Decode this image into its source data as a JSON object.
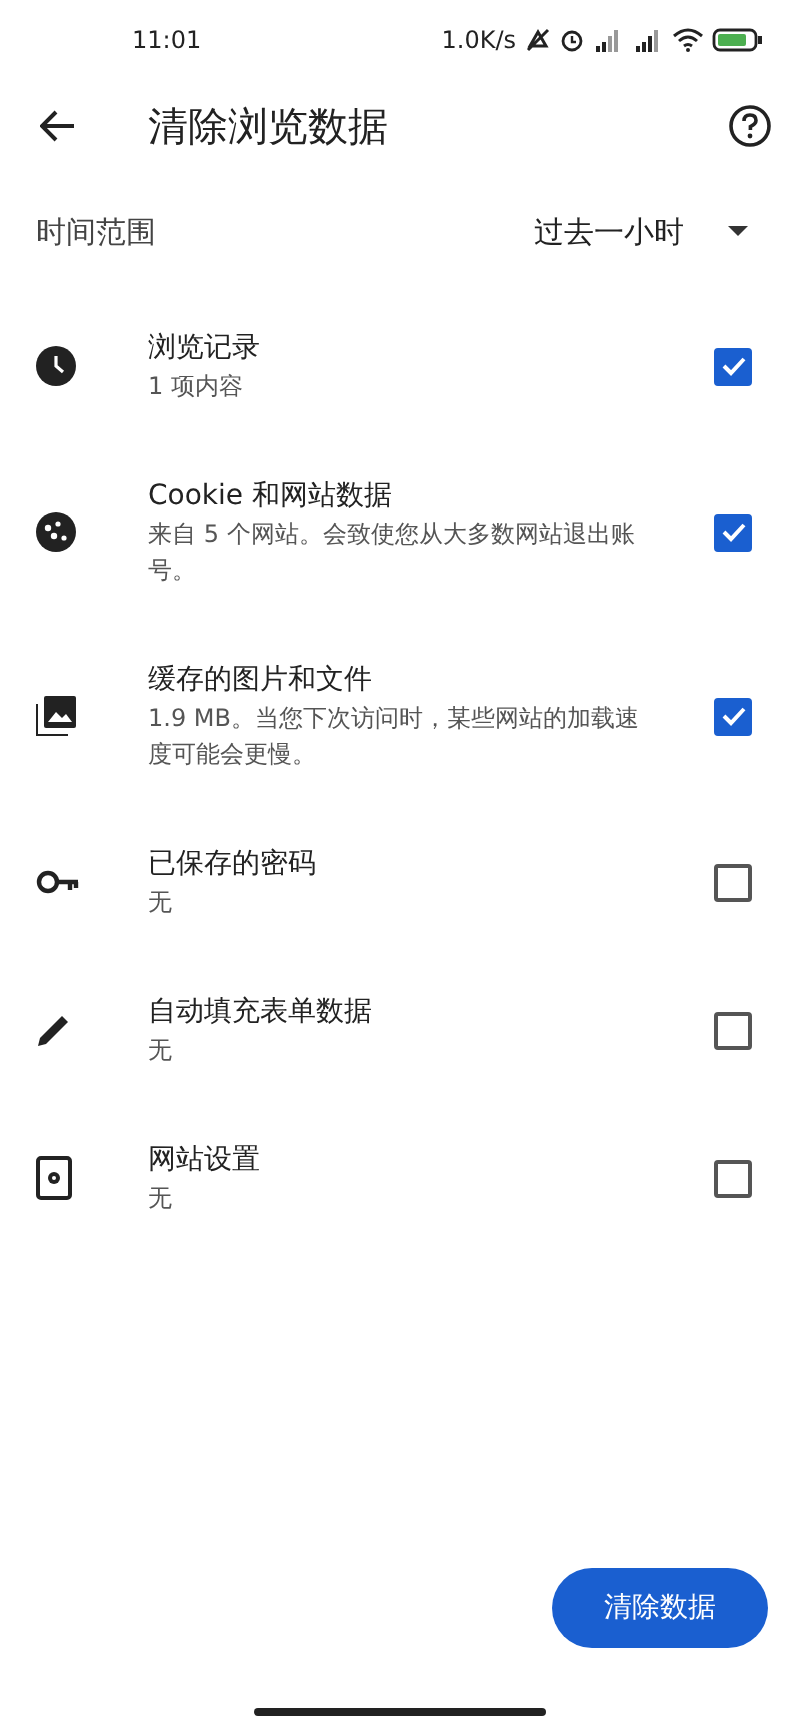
{
  "status_bar": {
    "time": "11:01",
    "speed": "1.0K/s"
  },
  "header": {
    "title": "清除浏览数据"
  },
  "time_range": {
    "label": "时间范围",
    "value": "过去一小时"
  },
  "items": [
    {
      "kind": "history",
      "title": "浏览记录",
      "subtitle": "1 项内容",
      "checked": true
    },
    {
      "kind": "cookie",
      "title": "Cookie 和网站数据",
      "subtitle": "来自 5 个网站。会致使您从大多数网站退出账号。",
      "checked": true
    },
    {
      "kind": "images",
      "title": "缓存的图片和文件",
      "subtitle": "1.9 MB。当您下次访问时，某些网站的加载速度可能会更慢。",
      "checked": true
    },
    {
      "kind": "password",
      "title": "已保存的密码",
      "subtitle": "无",
      "checked": false
    },
    {
      "kind": "autofill",
      "title": "自动填充表单数据",
      "subtitle": "无",
      "checked": false
    },
    {
      "kind": "site",
      "title": "网站设置",
      "subtitle": "无",
      "checked": false
    }
  ],
  "clear_button": "清除数据"
}
